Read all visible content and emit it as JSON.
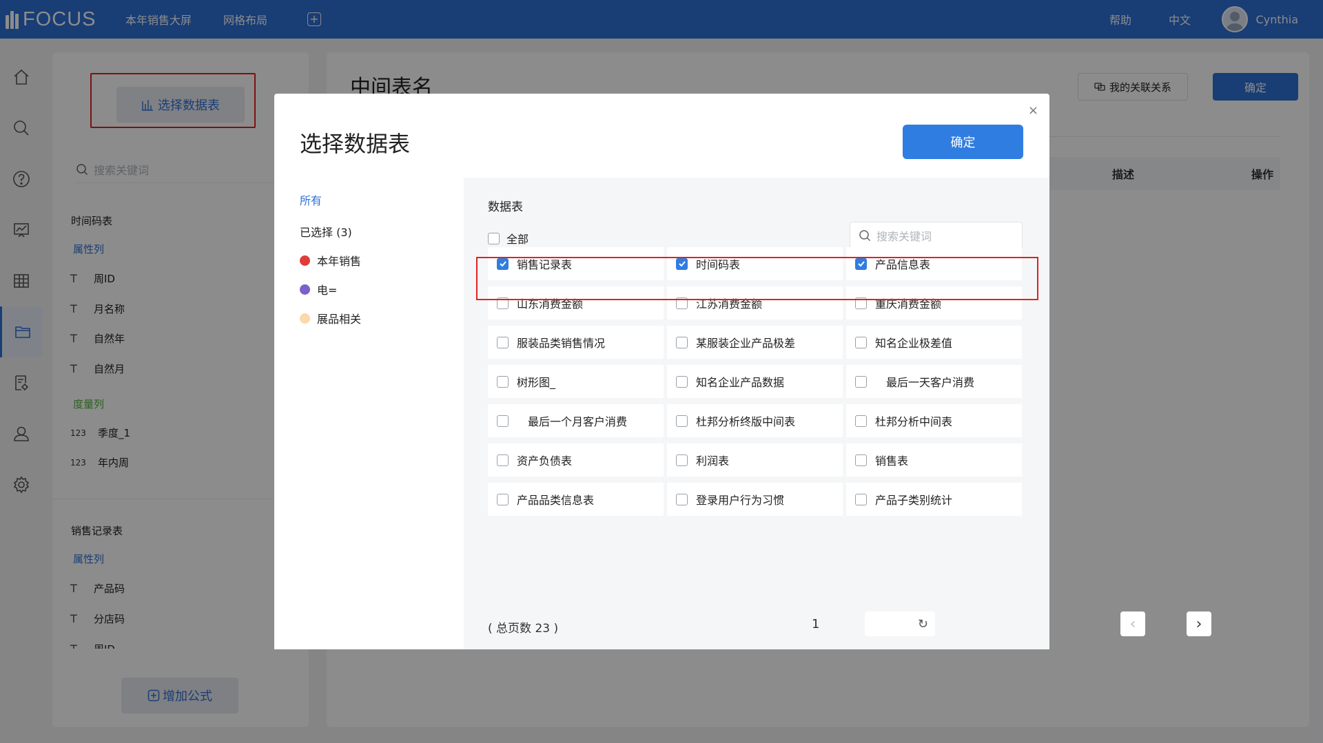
{
  "topbar": {
    "logo_text": "FOCUS",
    "nav": [
      "本年销售大屏",
      "网格布局"
    ],
    "add_tab_symbol": "+",
    "help": "帮助",
    "language": "中文",
    "username": "Cynthia"
  },
  "rail": {
    "icons": [
      "home-icon",
      "search-icon",
      "help-icon",
      "dashboard-icon",
      "table-icon",
      "folder-icon",
      "report-settings-icon",
      "user-icon",
      "settings-icon"
    ],
    "active": "folder-icon"
  },
  "left_panel": {
    "select_table_label": "选择数据表",
    "search_placeholder": "搜索关键词",
    "sections": [
      {
        "name": "时间码表",
        "attr_label": "属性列",
        "attr_fields": [
          "周ID",
          "月名称",
          "自然年",
          "自然月"
        ],
        "measure_label": "度量列",
        "measure_prefix": "123",
        "measure_fields": [
          "季度_1",
          "年内周"
        ]
      },
      {
        "name": "销售记录表",
        "attr_label": "属性列",
        "attr_fields": [
          "产品码",
          "分店码",
          "周ID"
        ]
      }
    ],
    "add_formula_label": "增加公式"
  },
  "right_panel": {
    "title": "中间表名",
    "relation_button": "我的关联关系",
    "confirm_button": "确定",
    "columns": [
      "描述",
      "操作"
    ]
  },
  "modal": {
    "title": "选择数据表",
    "confirm": "确定",
    "close_symbol": "×",
    "categories": {
      "all": "所有",
      "selected": "已选择 (3)",
      "groups": [
        {
          "label": "本年销售",
          "color": "#e03c3c"
        },
        {
          "label": "电=",
          "color": "#7b61c8"
        },
        {
          "label": "展品相关",
          "color": "#fbd9a8"
        }
      ]
    },
    "section_header": "数据表",
    "check_all": "全部",
    "search_placeholder": "搜索关键词",
    "tables": [
      {
        "label": "销售记录表",
        "checked": true
      },
      {
        "label": "时间码表",
        "checked": true
      },
      {
        "label": "产品信息表",
        "checked": true
      },
      {
        "label": "山东消费金额",
        "checked": false
      },
      {
        "label": "江苏消费金额",
        "checked": false
      },
      {
        "label": "重庆消费金额",
        "checked": false
      },
      {
        "label": "服装品类销售情况",
        "checked": false
      },
      {
        "label": "某服装企业产品极差",
        "checked": false
      },
      {
        "label": "知名企业极差值",
        "checked": false
      },
      {
        "label": "树形图_",
        "checked": false
      },
      {
        "label": "知名企业产品数据",
        "checked": false
      },
      {
        "label": "　最后一天客户消费",
        "checked": false
      },
      {
        "label": "　最后一个月客户消费",
        "checked": false
      },
      {
        "label": "杜邦分析终版中间表",
        "checked": false
      },
      {
        "label": "杜邦分析中间表",
        "checked": false
      },
      {
        "label": "资产负债表",
        "checked": false
      },
      {
        "label": "利润表",
        "checked": false
      },
      {
        "label": "销售表",
        "checked": false
      },
      {
        "label": "产品品类信息表",
        "checked": false
      },
      {
        "label": "登录用户行为习惯",
        "checked": false
      },
      {
        "label": "产品子类别统计",
        "checked": false
      }
    ],
    "pagination": {
      "total_text": "( 总页数 23 )",
      "current_page": "1",
      "prev_symbol": "‹",
      "next_symbol": "›",
      "jump_symbol": "↻"
    }
  }
}
